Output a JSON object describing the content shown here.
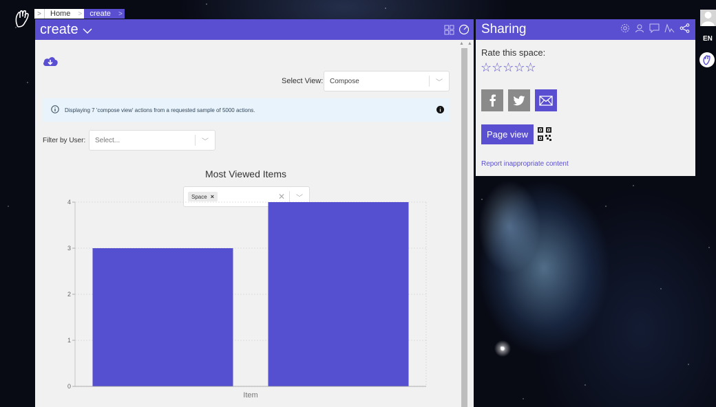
{
  "breadcrumb": {
    "items": [
      {
        "label": "Home"
      },
      {
        "label": "create"
      }
    ]
  },
  "main": {
    "title": "create",
    "select_view": {
      "label": "Select View:",
      "value": "Compose"
    },
    "info": {
      "text": "Displaying 7 'compose view' actions from a requested sample of 5000 actions."
    },
    "filter": {
      "label": "Filter by User:",
      "placeholder": "Select..."
    },
    "tag_filter": {
      "tag": "Space",
      "remove": "×"
    }
  },
  "chart_data": {
    "type": "bar",
    "title": "Most Viewed Items",
    "xlabel": "Item",
    "ylabel": "",
    "categories": [
      "",
      ""
    ],
    "values": [
      3,
      4
    ],
    "ylim": [
      0,
      4
    ],
    "yticks": [
      0,
      1,
      2,
      3,
      4
    ],
    "grid": true,
    "bar_color": "#5450d0"
  },
  "sharing": {
    "title": "Sharing",
    "rate_label": "Rate this space:",
    "star_count": 5,
    "stars": "☆☆☆☆☆",
    "page_view_label": "Page view",
    "report_label": "Report inappropriate content"
  },
  "topright": {
    "lang": "EN"
  },
  "colors": {
    "accent": "#5a4fd1",
    "panel": "#f1f1f1"
  }
}
